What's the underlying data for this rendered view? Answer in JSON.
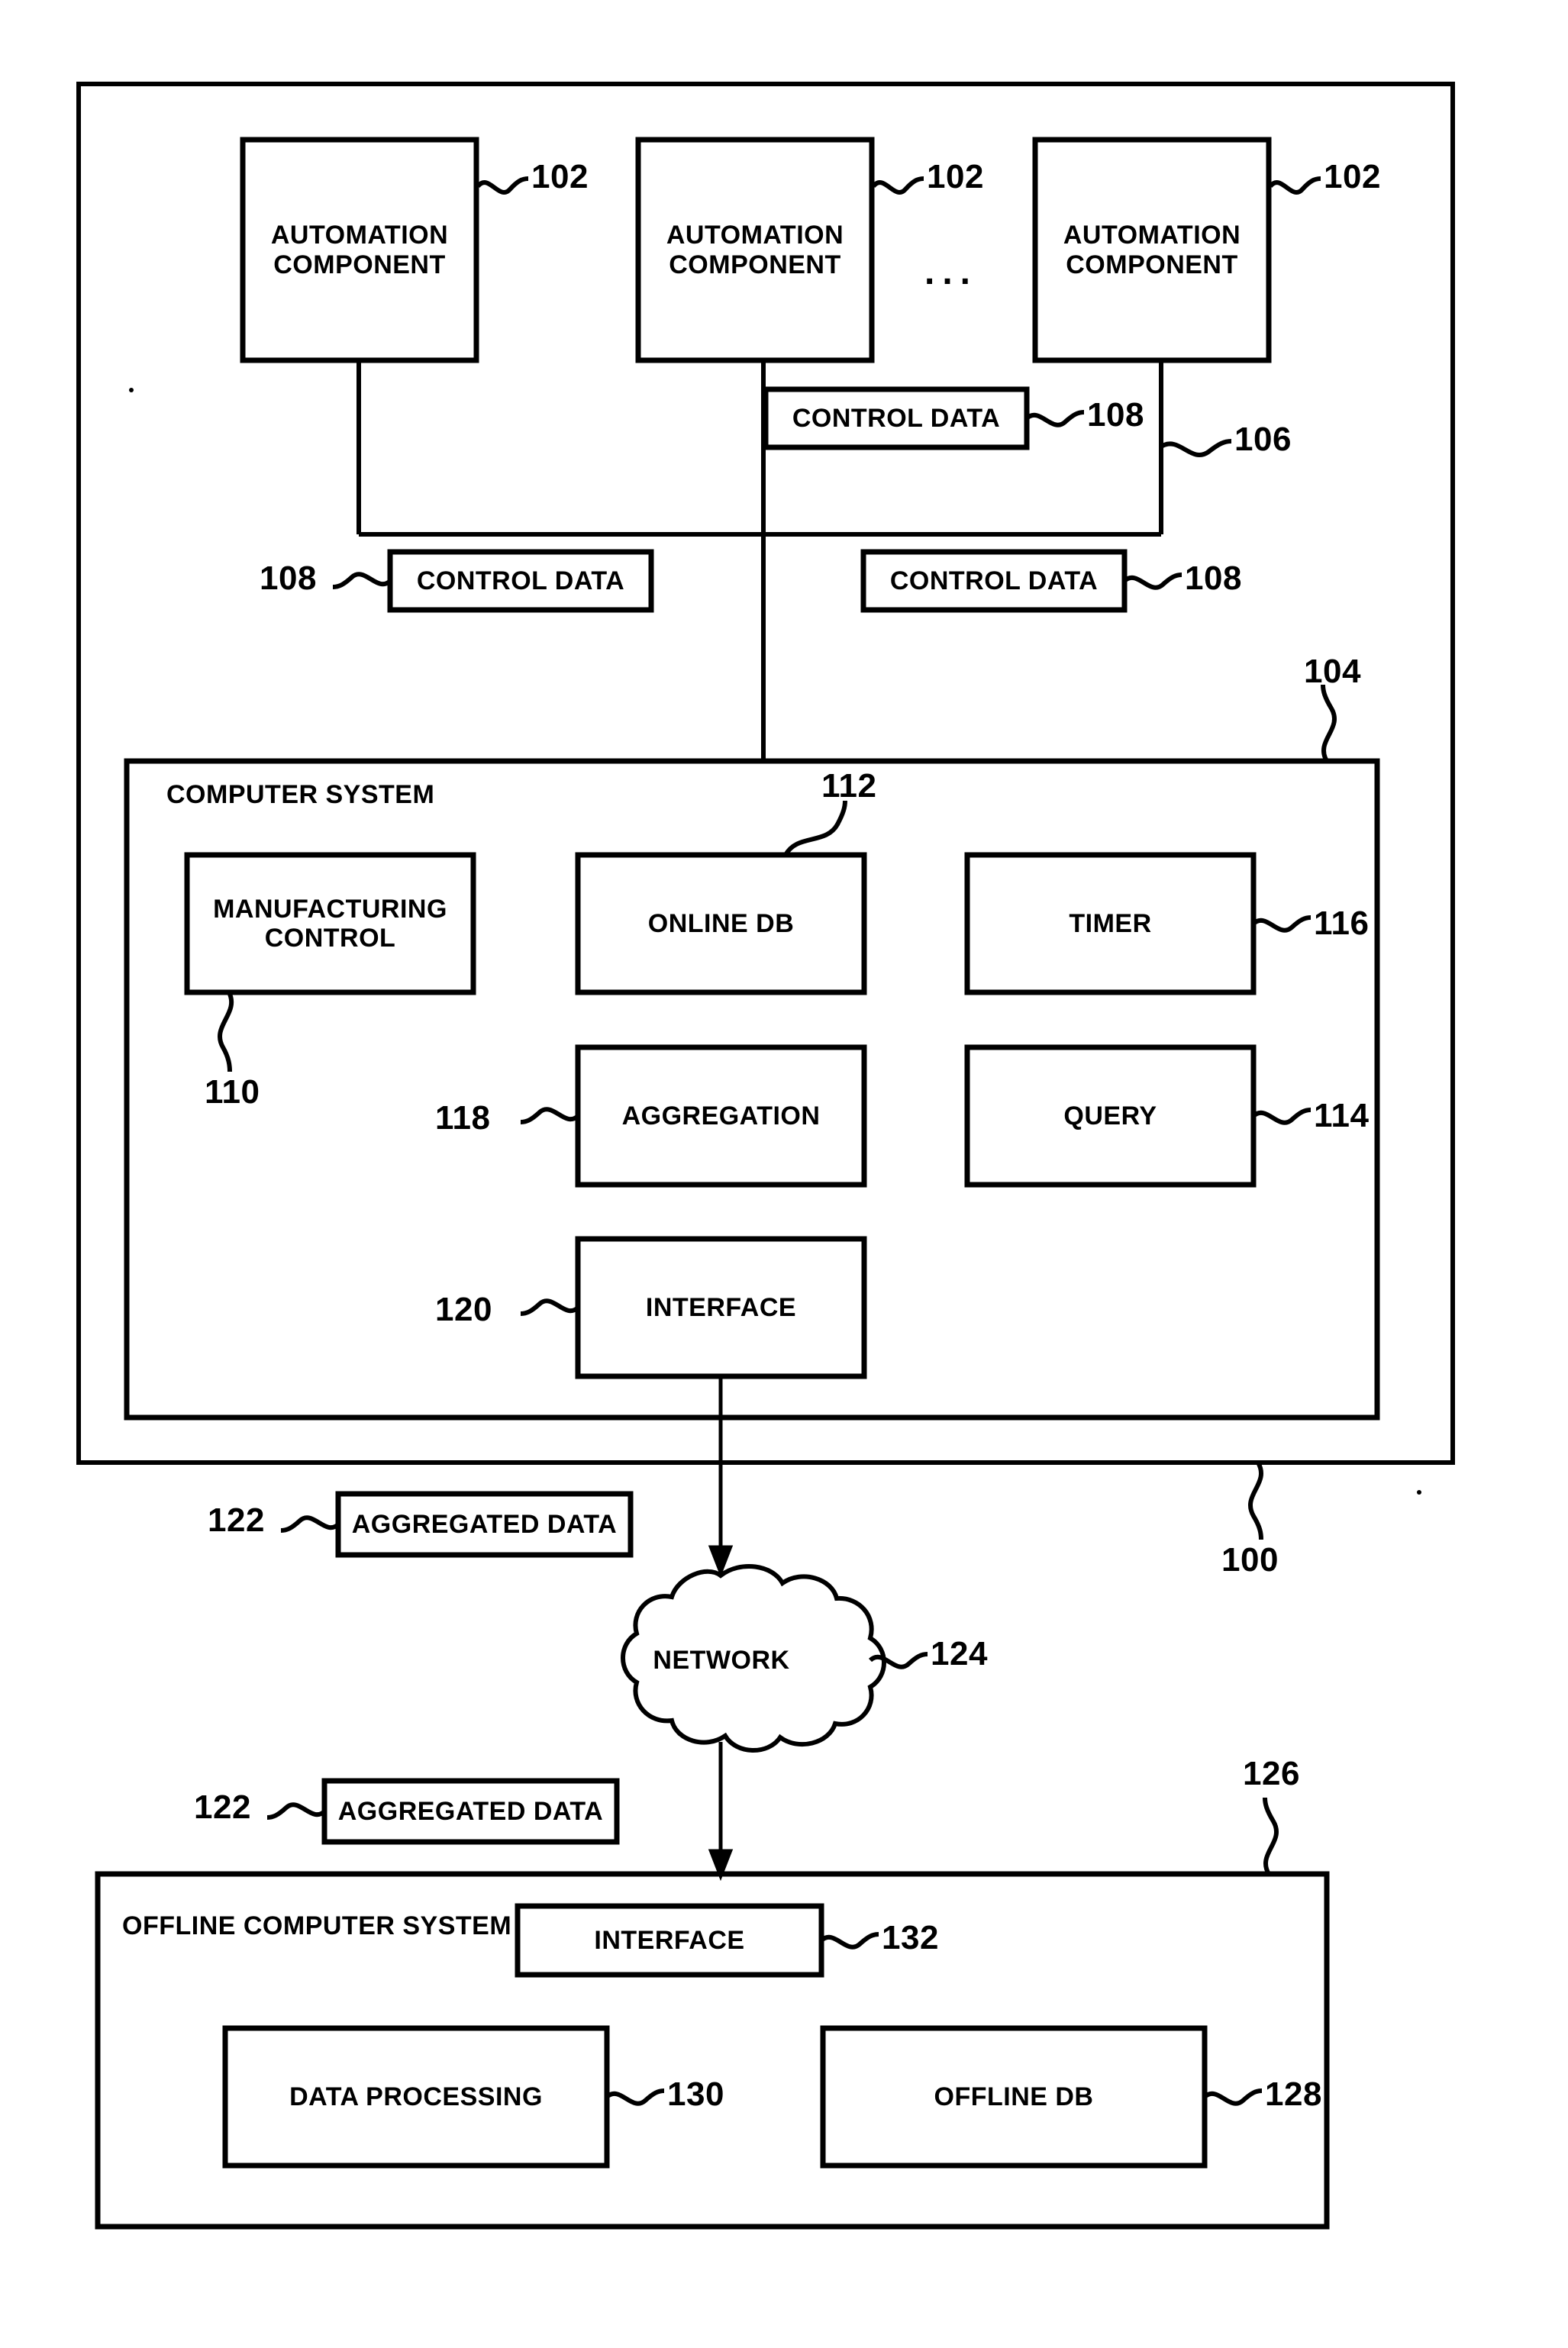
{
  "figure": {
    "type": "patent-block-diagram",
    "background": "#ffffff",
    "stroke": "#000000"
  },
  "outer_system": {
    "ref": "100",
    "label": ""
  },
  "automation_components": [
    {
      "label": "AUTOMATION\nCOMPONENT",
      "ref": "102"
    },
    {
      "label": "AUTOMATION\nCOMPONENT",
      "ref": "102"
    },
    {
      "label": "AUTOMATION\nCOMPONENT",
      "ref": "102"
    }
  ],
  "ellipsis": "...",
  "bus": {
    "ref": "106"
  },
  "control_data_blocks": [
    {
      "label": "CONTROL DATA",
      "ref": "108"
    },
    {
      "label": "CONTROL DATA",
      "ref": "108"
    },
    {
      "label": "CONTROL DATA",
      "ref": "108"
    }
  ],
  "computer_system": {
    "title": "COMPUTER SYSTEM",
    "ref": "104",
    "modules": [
      {
        "label": "MANUFACTURING\nCONTROL",
        "ref": "110"
      },
      {
        "label": "ONLINE DB",
        "ref": "112"
      },
      {
        "label": "TIMER",
        "ref": "116"
      },
      {
        "label": "AGGREGATION",
        "ref": "118"
      },
      {
        "label": "QUERY",
        "ref": "114"
      },
      {
        "label": "INTERFACE",
        "ref": "120"
      }
    ]
  },
  "aggregated_data_blocks": [
    {
      "label": "AGGREGATED DATA",
      "ref": "122"
    },
    {
      "label": "AGGREGATED DATA",
      "ref": "122"
    }
  ],
  "network": {
    "label": "NETWORK",
    "ref": "124"
  },
  "offline_computer_system": {
    "title": "OFFLINE COMPUTER SYSTEM",
    "ref": "126",
    "modules": [
      {
        "label": "INTERFACE",
        "ref": "132"
      },
      {
        "label": "DATA PROCESSING",
        "ref": "130"
      },
      {
        "label": "OFFLINE DB",
        "ref": "128"
      }
    ]
  }
}
